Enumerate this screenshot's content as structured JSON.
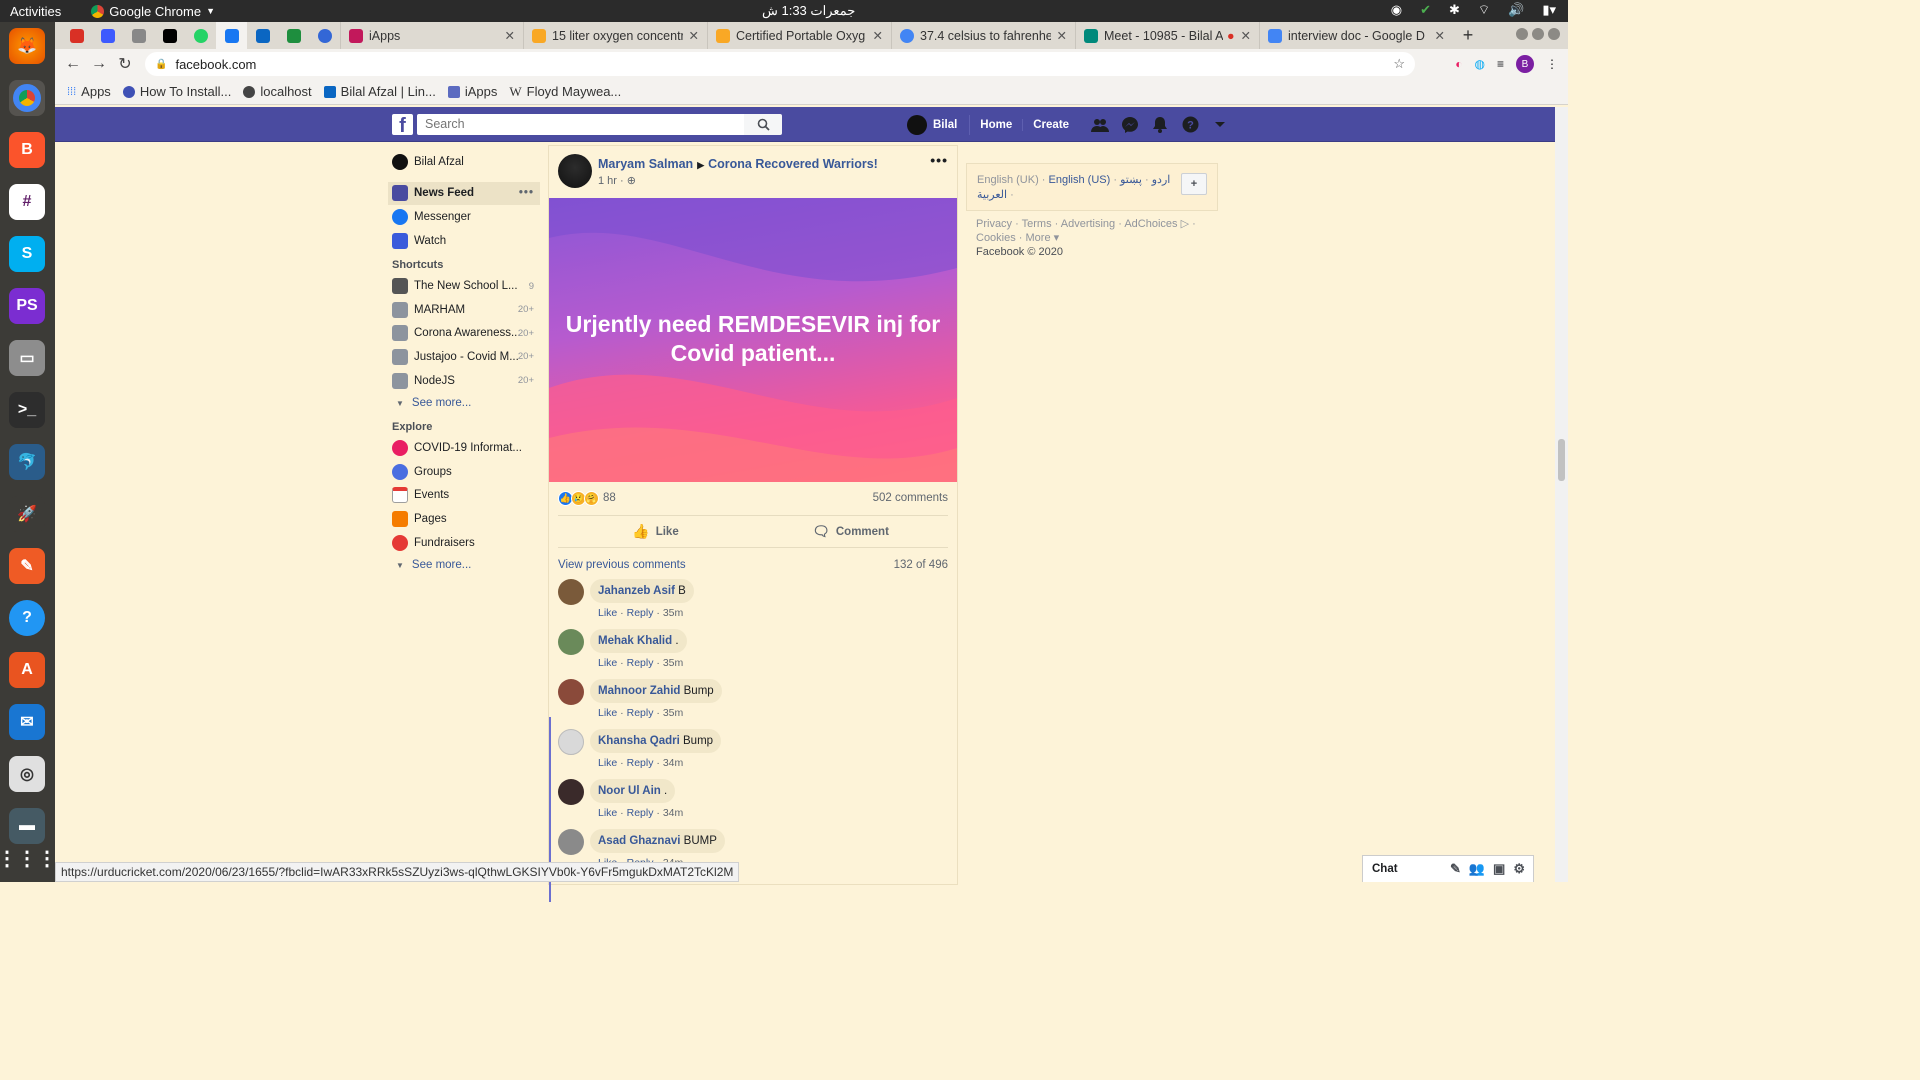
{
  "os": {
    "activities": "Activities",
    "app_name": "Google Chrome",
    "clock": "جمعرات  1:33 ش"
  },
  "browser": {
    "pinned_tabs": [
      {
        "icon": "gmail-icon",
        "color": "#d93025"
      },
      {
        "icon": "jira-icon",
        "color": "#3d5afe"
      },
      {
        "icon": "pocket-icon",
        "color": "#888888"
      },
      {
        "icon": "dev-icon",
        "color": "#000000"
      },
      {
        "icon": "whatsapp-icon",
        "color": "#25d366"
      },
      {
        "icon": "facebook-icon",
        "color": "#1877f2"
      },
      {
        "icon": "linkedin-icon",
        "color": "#0a66c2"
      },
      {
        "icon": "sheets-icon",
        "color": "#1e8e3e"
      },
      {
        "icon": "circle-icon",
        "color": "#3367d6"
      }
    ],
    "tabs": [
      {
        "label": "iApps",
        "icon_color": "#c2185b"
      },
      {
        "label": "15 liter oxygen concentr",
        "icon_color": "#f9a825"
      },
      {
        "label": "Certified Portable Oxyg",
        "icon_color": "#f9a825"
      },
      {
        "label": "37.4 celsius to fahrenhe",
        "icon_color": "#4285f4"
      },
      {
        "label": "Meet - 10985 - Bilal A",
        "icon_color": "#00897b"
      },
      {
        "label": "interview doc - Google D",
        "icon_color": "#4285f4"
      }
    ],
    "url": "facebook.com",
    "profile_initial": "B",
    "bookmarks": [
      {
        "label": "Apps",
        "color": "#4285f4"
      },
      {
        "label": "How To Install...",
        "color": "#3f51b5"
      },
      {
        "label": "localhost",
        "color": "#444444"
      },
      {
        "label": "Bilal Afzal | Lin...",
        "color": "#0a66c2"
      },
      {
        "label": "iApps",
        "color": "#5c6bc0"
      },
      {
        "label": "Floyd Maywea...",
        "color": "#444444"
      }
    ],
    "status_url": "https://urducricket.com/2020/06/23/1655/?fbclid=IwAR33xRRk5sSZUyzi3ws-qlQthwLGKSIYVb0k-Y6vFr5mgukDxMAT2TcKl2M"
  },
  "fb": {
    "search_placeholder": "Search",
    "user_name": "Bilal",
    "home": "Home",
    "create": "Create",
    "left": {
      "profile": "Bilal Afzal",
      "main": [
        {
          "label": "News Feed",
          "color": "#4a4ba0"
        },
        {
          "label": "Messenger",
          "color": "#1877f2"
        },
        {
          "label": "Watch",
          "color": "#3b5bdb"
        }
      ],
      "shortcuts_heading": "Shortcuts",
      "shortcuts": [
        {
          "label": "The New School L...",
          "count": "9"
        },
        {
          "label": "MARHAM",
          "count": "20+"
        },
        {
          "label": "Corona Awareness...",
          "count": "20+"
        },
        {
          "label": "Justajoo - Covid M...",
          "count": "20+"
        },
        {
          "label": "NodeJS",
          "count": "20+"
        }
      ],
      "see_more": "See more...",
      "explore_heading": "Explore",
      "explore": [
        {
          "label": "COVID-19 Informat...",
          "color": "#e91e63"
        },
        {
          "label": "Groups",
          "color": "#4a6ee0"
        },
        {
          "label": "Events",
          "color": "#9e9e9e"
        },
        {
          "label": "Pages",
          "color": "#f57c00"
        },
        {
          "label": "Fundraisers",
          "color": "#e53935"
        }
      ],
      "see_more2": "See more..."
    },
    "post": {
      "author": "Maryam Salman",
      "group": "Corona Recovered Warriors!",
      "time": "1 hr ·",
      "text": "Urjently need REMDESEVIR inj for Covid patient...",
      "reaction_count": "88",
      "comments_count": "502 comments",
      "like": "Like",
      "comment": "Comment",
      "view_previous": "View previous comments",
      "page_count": "132 of 496",
      "comments": [
        {
          "name": "Jahanzeb Asif",
          "text": "B",
          "time": "35m",
          "avatar": "#7a5a3a"
        },
        {
          "name": "Mehak Khalid",
          "text": ".",
          "time": "35m",
          "avatar": "#6a8a5a"
        },
        {
          "name": "Mahnoor Zahid",
          "text": "Bump",
          "time": "35m",
          "avatar": "#8a4a3a"
        },
        {
          "name": "Khansha Qadri",
          "text": "Bump",
          "time": "34m",
          "avatar": "#d9d9d9"
        },
        {
          "name": "Noor Ul Ain",
          "text": ".",
          "time": "34m",
          "avatar": "#3a2a2a"
        },
        {
          "name": "Asad Ghaznavi",
          "text": "BUMP",
          "time": "34m",
          "avatar": "#8a8a8a"
        }
      ],
      "c_like": "Like",
      "c_reply": "Reply"
    },
    "right": {
      "lang1": "English (UK)",
      "lang2": "English (US)",
      "lang3": "اردو",
      "lang4": "پښتو",
      "lang5": "العربية",
      "footer1": "Privacy · Terms · Advertising · AdChoices ▷ ·",
      "footer2": "Cookies · More ▾",
      "copyright": "Facebook © 2020"
    },
    "chat": "Chat"
  }
}
